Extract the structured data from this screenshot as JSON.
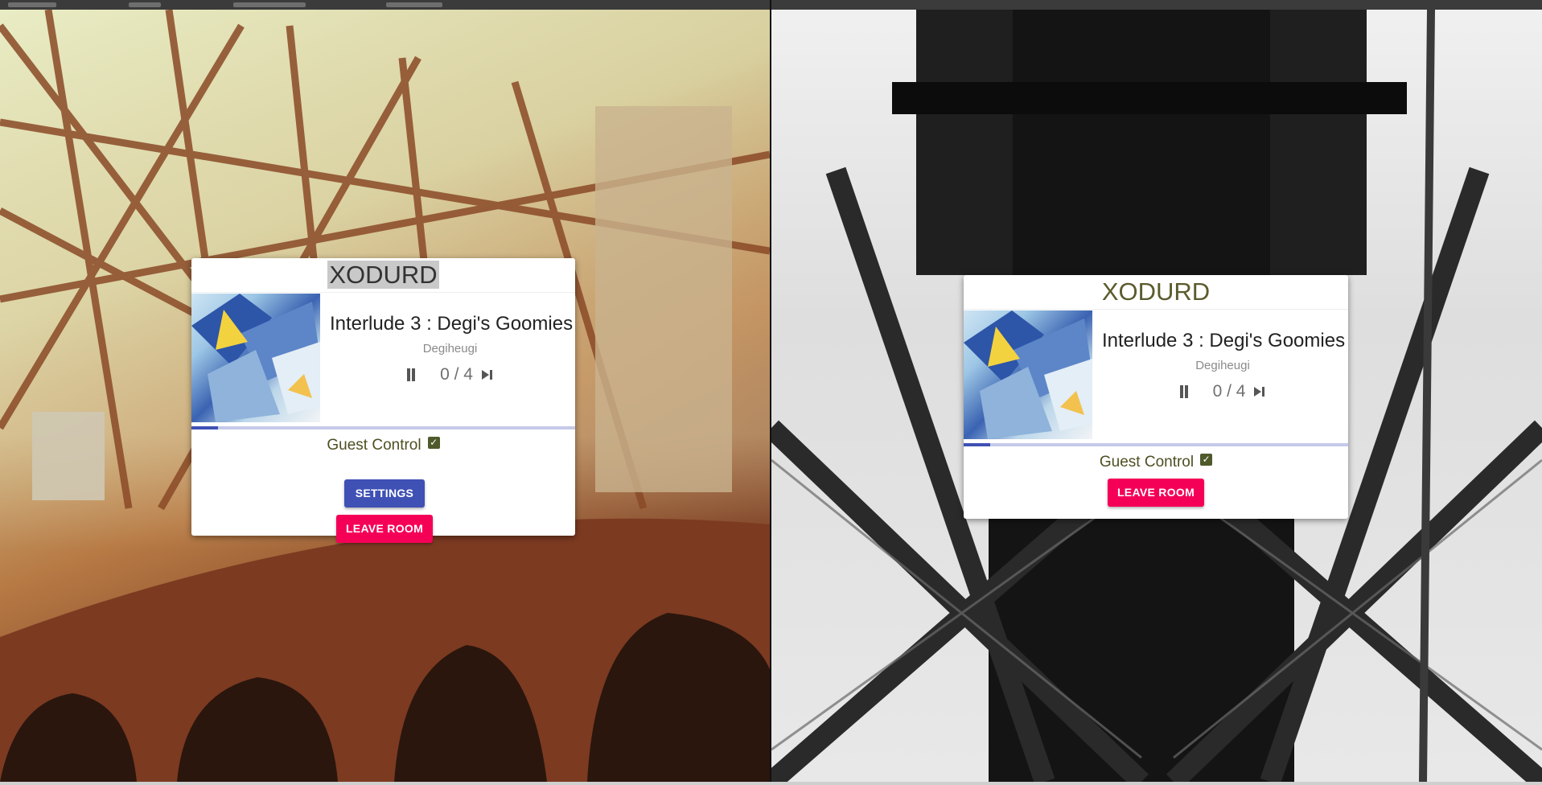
{
  "colors": {
    "primary": "#3f51b5",
    "accent": "#f50057",
    "progress_track": "#c5cae9",
    "guest_text": "#4f4f23"
  },
  "left_window": {
    "room_code": "XODURD",
    "track": {
      "title": "Interlude 3 : Degi's Goomies",
      "artist": "Degiheugi",
      "position": "0 / 4",
      "progress_fraction": 0.07
    },
    "icons": {
      "play_state": "pause-icon",
      "next": "skip-next-icon",
      "guest_check": "checkbox-checked-icon"
    },
    "guest_control_label": "Guest Control",
    "settings_label": "SETTINGS",
    "leave_label": "LEAVE ROOM"
  },
  "right_window": {
    "room_code": "XODURD",
    "track": {
      "title": "Interlude 3 : Degi's Goomies",
      "artist": "Degiheugi",
      "position": "0 / 4",
      "progress_fraction": 0.07
    },
    "icons": {
      "play_state": "pause-icon",
      "next": "skip-next-icon",
      "guest_check": "checkbox-checked-icon"
    },
    "guest_control_label": "Guest Control",
    "leave_label": "LEAVE ROOM"
  }
}
